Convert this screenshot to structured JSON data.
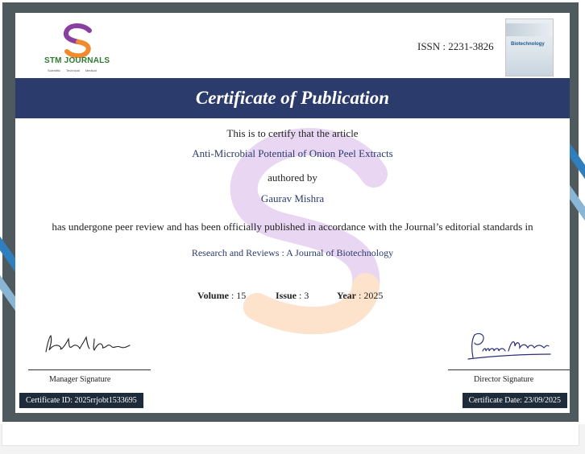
{
  "journal_brand": {
    "name": "STM JOURNALS",
    "tagline": "Scientific   Technical   Medical",
    "logo_icon": "stm-s-logo"
  },
  "issn": "ISSN : 2231-3826",
  "cover": {
    "title": "Biotechnology",
    "icon": "journal-cover-thumbnail"
  },
  "certificate": {
    "title": "Certificate of Publication",
    "intro": "This is to certify that the article",
    "article_title": "Anti-Microbial Potential of Onion Peel Extracts",
    "authored_by": "authored by",
    "author": "Gaurav Mishra",
    "statement": "has undergone peer review and has been officially published in accordance with the Journal’s editorial standards in",
    "journal_name": "Research and Reviews : A Journal of Biotechnology",
    "volume_label": "Volume",
    "volume": "15",
    "issue_label": "Issue",
    "issue": "3",
    "year_label": "Year",
    "year": "2025"
  },
  "signatures": {
    "manager": {
      "signature_text": "Rahul Kumar",
      "label": "Manager Signature"
    },
    "director": {
      "signature_text": "Puneet Mehrotra",
      "label": "Director Signature"
    }
  },
  "footer": {
    "certificate_id": "Certificate ID: 2025rrjobt1533695",
    "certificate_date": "Certificate Date: 23/09/2025"
  },
  "colors": {
    "banner": "#2b3b6b",
    "frame": "#4f5a5f",
    "accent_blue": "#2f7fbf",
    "brand_green": "#2d7a32",
    "logo_purple": "#8a3fa0",
    "logo_orange": "#f08a2c"
  }
}
